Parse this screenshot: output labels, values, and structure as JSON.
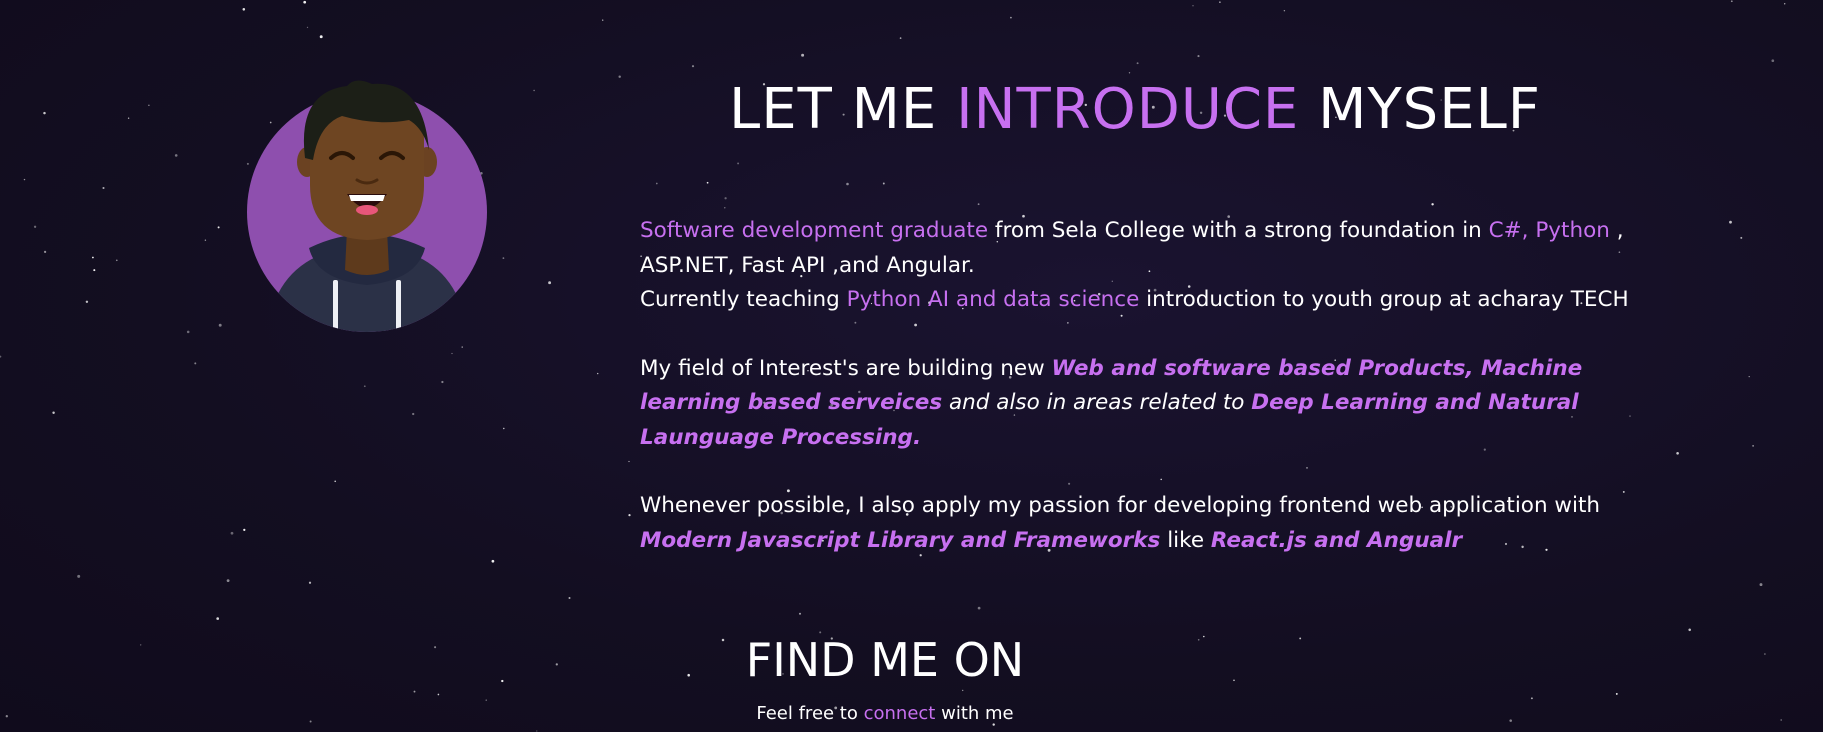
{
  "theme": {
    "accent_color": "#c770f0",
    "background_color": "#140f24",
    "text_color": "#ffffff"
  },
  "avatar": {
    "icon": "cartoon-avatar-icon",
    "circle_color": "#8e4fae"
  },
  "about": {
    "title_pre": "LET ME",
    "title_accent": "INTRODUCE",
    "title_post": "MYSELF",
    "p1": {
      "hl1": "Software development graduate",
      "t1": " from Sela College with a strong foundation in ",
      "hl2": "C#, Python",
      "t2": " , ASP.NET, Fast API ,and Angular.",
      "t3": "Currently teaching ",
      "hl3": "Python AI and data science",
      "t4": " introduction to youth group at acharay TECH"
    },
    "p2": {
      "t1": "My field of Interest's are building new ",
      "hl1": "Web and software based Products, Machine learning based serveices",
      "t2": " and also in areas related to ",
      "hl2": "Deep Learning and Natural Launguage Processing."
    },
    "p3": {
      "t1": "Whenever possible, I also apply my passion for developing frontend web application with ",
      "hl1": "Modern Javascript Library and Frameworks",
      "t2": " like ",
      "hl2": "React.js and Angualr"
    }
  },
  "find": {
    "title": "FIND ME ON",
    "sub_pre": "Feel free to ",
    "sub_link": "connect",
    "sub_post": " with me"
  }
}
